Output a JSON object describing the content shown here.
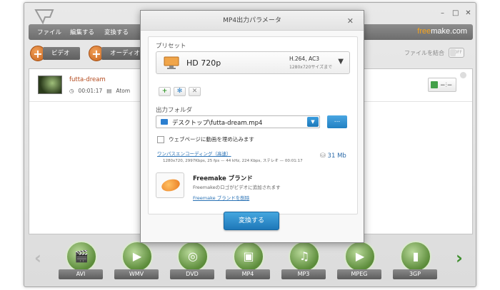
{
  "app": {
    "menu": [
      "ファイル",
      "編集する",
      "変換する"
    ],
    "brand_free": "free",
    "brand_make": "make.com",
    "toolbar": {
      "video_label": "ビデオ",
      "audio_label": "オーディオ",
      "merge_label": "ファイルを結合",
      "toggle_label": "OFF"
    },
    "file": {
      "name": "futta-dream",
      "duration": "00:01:17",
      "codec": "Atom"
    },
    "formats": [
      "AVI",
      "WMV",
      "DVD",
      "MP4",
      "MP3",
      "MPEG",
      "3GP"
    ]
  },
  "dialog": {
    "title": "MP4出力パラメータ",
    "preset_label": "プリセット",
    "preset": {
      "name": "HD 720p",
      "codec": "H.264, AC3",
      "size": "1280x720サイズまで"
    },
    "folder_label": "出力フォルダ",
    "folder_value": "デスクトップ\\futta-dream.mp4",
    "browse_label": "...",
    "embed_label": "ウェブページに動画を埋め込みます",
    "encode_link": "ワンパスエンコーディング（高速）",
    "encode_specs": "1280x720, 2997Kbps, 25 fps — 44 kHz, 224 Kbps, ステレオ — 00:01:17",
    "file_size": "31 Mb",
    "brand_title": "Freemake ブランド",
    "brand_desc": "Freemakeのロゴがビデオに追加されます",
    "brand_link": "Freemake ブランドを削除",
    "convert_label": "変換する"
  },
  "colors": {
    "accent_orange": "#f6a21a",
    "button_blue": "#2180c2",
    "link_blue": "#2a72b5"
  }
}
